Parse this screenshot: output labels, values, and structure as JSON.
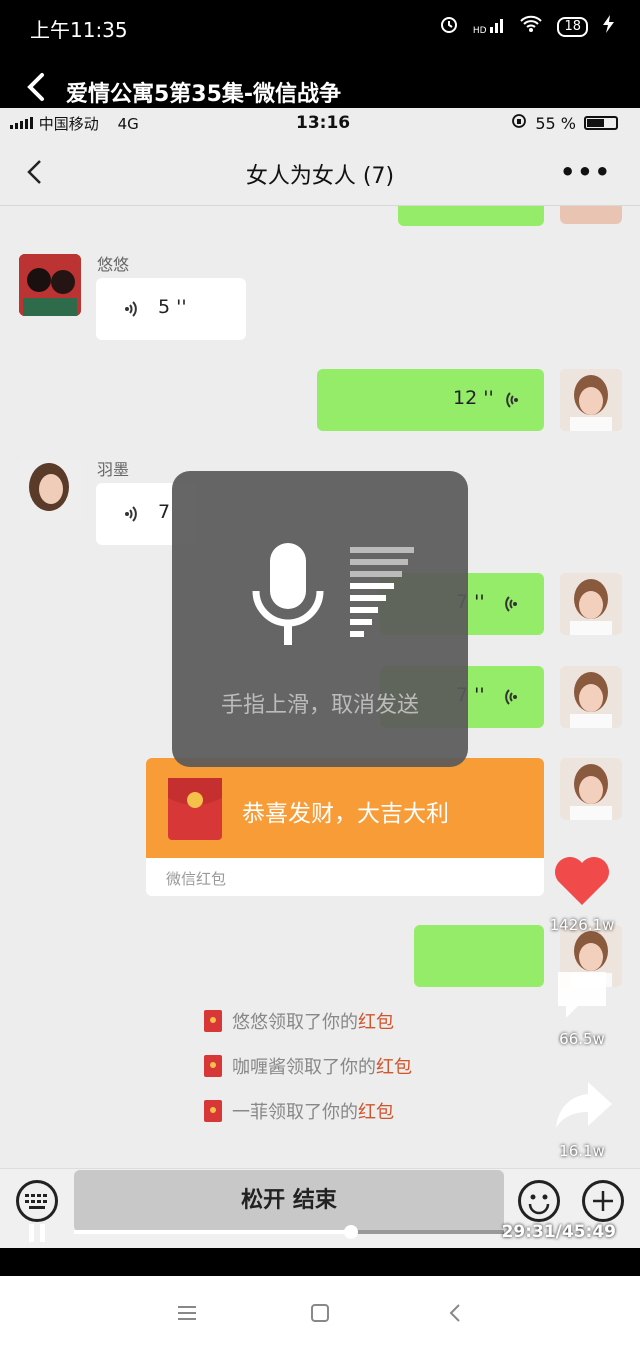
{
  "outer_status": {
    "time": "上午11:35",
    "battery": "18",
    "network": "HD"
  },
  "video": {
    "title": "爱情公寓5第35集-微信战争"
  },
  "inner_status": {
    "carrier": "中国移动",
    "network": "4G",
    "time": "13:16",
    "battery": "55 %"
  },
  "chat": {
    "title": "女人为女人 (7)",
    "more": "•••"
  },
  "messages": {
    "youyou_name": "悠悠",
    "youyou_voice": "5 ''",
    "me_voice_1": "12 ''",
    "yumo_name": "羽墨",
    "yumo_voice": "7",
    "me_voice_2": "7 ''",
    "me_voice_3": "7 ''"
  },
  "recording": {
    "hint": "手指上滑，取消发送"
  },
  "red_packet": {
    "greeting": "恭喜发财，大吉大利",
    "footer": "微信红包"
  },
  "system_lines": [
    {
      "who": "悠悠领取了你的",
      "what": "红包"
    },
    {
      "who": "咖喱酱领取了你的",
      "what": "红包"
    },
    {
      "who": "一菲领取了你的",
      "what": "红包"
    }
  ],
  "input": {
    "release_label": "松开 结束"
  },
  "side_actions": {
    "likes": "1426.1w",
    "comments": "66.5w",
    "shares": "16.1w"
  },
  "player": {
    "timecode": "29:31/45:49",
    "progress": 0.644
  },
  "colors": {
    "bubble_green": "#95ec69",
    "packet_orange": "#f79c37",
    "heart_red": "#f04a4a"
  }
}
